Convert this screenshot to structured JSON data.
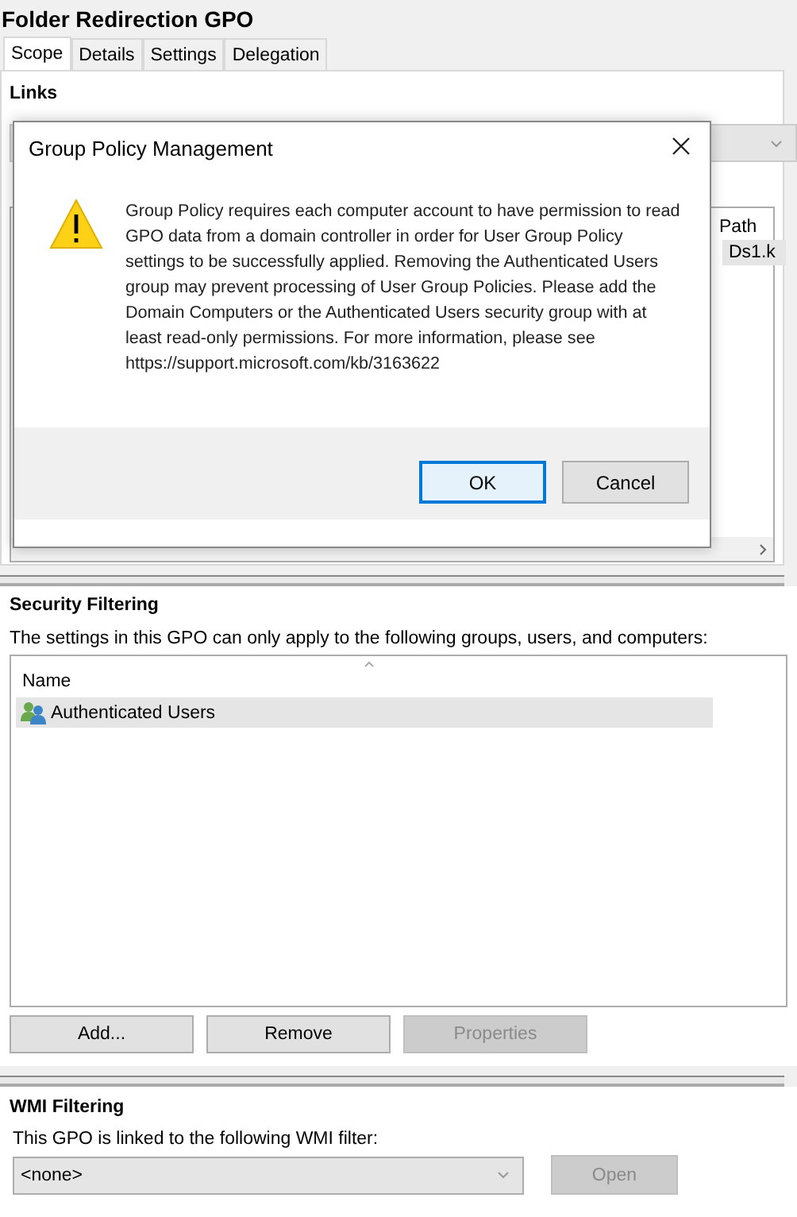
{
  "window": {
    "title": "Folder Redirection GPO"
  },
  "tabs": [
    {
      "label": "Scope",
      "selected": true
    },
    {
      "label": "Details",
      "selected": false
    },
    {
      "label": "Settings",
      "selected": false
    },
    {
      "label": "Delegation",
      "selected": false
    }
  ],
  "links": {
    "heading": "Links",
    "columns": [
      "Path"
    ],
    "rows": [
      {
        "path": "Ds1.k",
        "selected": true
      }
    ]
  },
  "dialog": {
    "title": "Group Policy Management",
    "message": "Group Policy requires each computer account to have permission to read GPO data from a domain controller in order for User Group Policy settings to be successfully applied. Removing the Authenticated Users group may prevent processing of User Group Policies. Please add the Domain Computers or the Authenticated Users security group with at least read-only permissions. For more information, please see https://support.microsoft.com/kb/3163622",
    "buttons": [
      {
        "label": "OK",
        "default": true
      },
      {
        "label": "Cancel",
        "default": false
      }
    ]
  },
  "security_filtering": {
    "heading": "Security Filtering",
    "description": "The settings in this GPO can only apply to the following groups, users, and computers:",
    "columns": [
      "Name"
    ],
    "rows": [
      {
        "name": "Authenticated Users",
        "selected": true
      }
    ],
    "buttons": [
      {
        "label": "Add...",
        "disabled": false
      },
      {
        "label": "Remove",
        "disabled": false
      },
      {
        "label": "Properties",
        "disabled": true
      }
    ]
  },
  "wmi_filtering": {
    "heading": "WMI Filtering",
    "label": "This GPO is linked to the following WMI filter:",
    "dropdown": {
      "value": "<none>"
    },
    "button": {
      "label": "Open",
      "disabled": true
    }
  }
}
